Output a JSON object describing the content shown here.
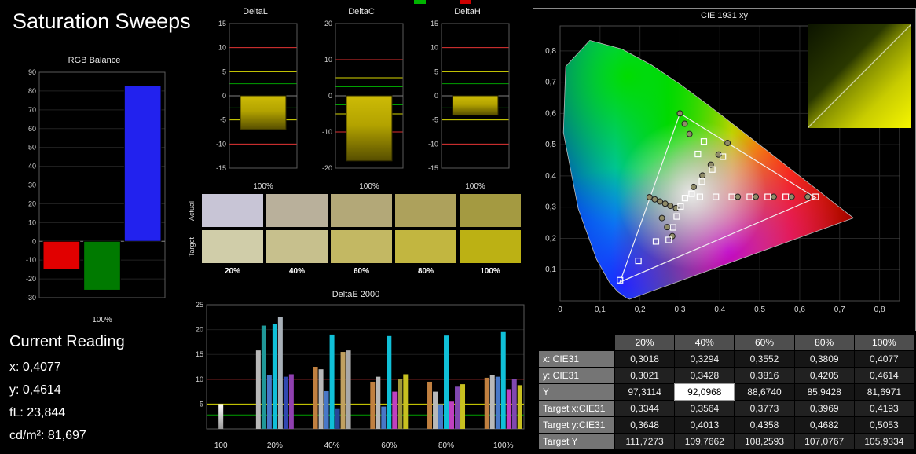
{
  "window": {
    "title": "Saturation Sweeps"
  },
  "top_markers": [
    {
      "name": "green-marker",
      "color": "#00b400"
    },
    {
      "name": "red-marker",
      "color": "#cc0000"
    }
  ],
  "current_reading": {
    "title": "Current Reading",
    "lines": [
      "x: 0,4077",
      "y: 0,4614",
      "fL: 23,844",
      "cd/m²: 81,697"
    ]
  },
  "swatches": {
    "row_labels": [
      "Actual",
      "Target"
    ],
    "col_labels": [
      "20%",
      "40%",
      "60%",
      "80%",
      "100%"
    ],
    "actual_colors": [
      "#c8c5d6",
      "#b9b09b",
      "#b3a878",
      "#ada15c",
      "#a49a41"
    ],
    "target_colors": [
      "#d0cda9",
      "#c7c08d",
      "#c3b863",
      "#c2b640",
      "#bcb114"
    ]
  },
  "table": {
    "col_headers": [
      "",
      "20%",
      "40%",
      "60%",
      "80%",
      "100%"
    ],
    "rows": [
      {
        "label": "x: CIE31",
        "values": [
          "0,3018",
          "0,3294",
          "0,3552",
          "0,3809",
          "0,4077"
        ]
      },
      {
        "label": "y: CIE31",
        "values": [
          "0,3021",
          "0,3428",
          "0,3816",
          "0,4205",
          "0,4614"
        ]
      },
      {
        "label": "Y",
        "values": [
          "97,3114",
          "92,0968",
          "88,6740",
          "85,9428",
          "81,6971"
        ]
      },
      {
        "label": "Target x:CIE31",
        "values": [
          "0,3344",
          "0,3564",
          "0,3773",
          "0,3969",
          "0,4193"
        ]
      },
      {
        "label": "Target y:CIE31",
        "values": [
          "0,3648",
          "0,4013",
          "0,4358",
          "0,4682",
          "0,5053"
        ]
      },
      {
        "label": "Target Y",
        "values": [
          "111,7273",
          "109,7662",
          "108,2593",
          "107,0767",
          "105,9334"
        ]
      }
    ],
    "highlight": {
      "row": 2,
      "col": 1
    }
  },
  "chart_data": [
    {
      "type": "bar",
      "id": "rgb-balance",
      "title": "RGB Balance",
      "xlabel": "100%",
      "ylim": [
        -30,
        90
      ],
      "yticks": [
        90,
        80,
        70,
        60,
        50,
        40,
        30,
        20,
        10,
        0,
        -10,
        -20,
        -30
      ],
      "categories": [
        "Red",
        "Green",
        "Blue"
      ],
      "values": [
        -15,
        -26,
        83
      ],
      "colors": [
        "#e10000",
        "#007a00",
        "#2222ee"
      ]
    },
    {
      "type": "bar",
      "id": "deltaL",
      "title": "DeltaL",
      "xlabel": "100%",
      "ylim": [
        -15,
        15
      ],
      "yticks": [
        15,
        10,
        5,
        0,
        -5,
        -10,
        -15
      ],
      "values": [
        -7
      ],
      "colors": [
        "#b3a300"
      ],
      "ref_lines": [
        {
          "v": 10,
          "c": "#e03030"
        },
        {
          "v": 5,
          "c": "#d8d800"
        },
        {
          "v": 2.5,
          "c": "#00a000"
        },
        {
          "v": -2.5,
          "c": "#00a000"
        },
        {
          "v": -5,
          "c": "#d8d800"
        },
        {
          "v": -10,
          "c": "#e03030"
        }
      ]
    },
    {
      "type": "bar",
      "id": "deltaC",
      "title": "DeltaC",
      "xlabel": "100%",
      "ylim": [
        -20,
        20
      ],
      "yticks": [
        20,
        10,
        0,
        -10,
        -20
      ],
      "values": [
        -18
      ],
      "colors": [
        "#b3a300"
      ],
      "ref_lines": [
        {
          "v": 10,
          "c": "#e03030"
        },
        {
          "v": 5,
          "c": "#d8d800"
        },
        {
          "v": 2.5,
          "c": "#00a000"
        },
        {
          "v": -2.5,
          "c": "#00a000"
        },
        {
          "v": -5,
          "c": "#d8d800"
        },
        {
          "v": -10,
          "c": "#e03030"
        }
      ]
    },
    {
      "type": "bar",
      "id": "deltaH",
      "title": "DeltaH",
      "xlabel": "100%",
      "ylim": [
        -15,
        15
      ],
      "yticks": [
        15,
        10,
        5,
        0,
        -5,
        -10,
        -15
      ],
      "values": [
        -4
      ],
      "colors": [
        "#b3a300"
      ],
      "ref_lines": [
        {
          "v": 10,
          "c": "#e03030"
        },
        {
          "v": 5,
          "c": "#d8d800"
        },
        {
          "v": 2.5,
          "c": "#00a000"
        },
        {
          "v": -2.5,
          "c": "#00a000"
        },
        {
          "v": -5,
          "c": "#d8d800"
        },
        {
          "v": -10,
          "c": "#e03030"
        }
      ]
    },
    {
      "type": "grouped-bar",
      "id": "deltae-2000",
      "title": "DeltaE 2000",
      "ylim": [
        0,
        25
      ],
      "yticks": [
        25,
        20,
        15,
        10,
        5
      ],
      "ref_lines": [
        {
          "v": 10,
          "c": "#e03030"
        },
        {
          "v": 5,
          "c": "#d8d800"
        },
        {
          "v": 2.8,
          "c": "#00a000"
        }
      ],
      "groups": [
        {
          "label": "100",
          "bars": [
            {
              "v": 5.0,
              "c": "#f2f2f2"
            }
          ]
        },
        {
          "label": "20%",
          "bars": [
            {
              "v": 15.8,
              "c": "#b8b8b8"
            },
            {
              "v": 20.8,
              "c": "#209898"
            },
            {
              "v": 10.8,
              "c": "#4878c8"
            },
            {
              "v": 21.2,
              "c": "#10c0d8"
            },
            {
              "v": 22.5,
              "c": "#a8b0b8"
            },
            {
              "v": 10.5,
              "c": "#3048b0"
            },
            {
              "v": 11.0,
              "c": "#9040b0"
            }
          ]
        },
        {
          "label": "40%",
          "bars": [
            {
              "v": 12.5,
              "c": "#c08040"
            },
            {
              "v": 12.0,
              "c": "#b8b8b8"
            },
            {
              "v": 7.6,
              "c": "#4878c8"
            },
            {
              "v": 19.0,
              "c": "#10c0d8"
            },
            {
              "v": 4.0,
              "c": "#284898"
            },
            {
              "v": 15.5,
              "c": "#c0a060"
            },
            {
              "v": 15.8,
              "c": "#a8a8a8"
            }
          ]
        },
        {
          "label": "60%",
          "bars": [
            {
              "v": 9.5,
              "c": "#c08040"
            },
            {
              "v": 10.5,
              "c": "#b8b8b8"
            },
            {
              "v": 4.5,
              "c": "#4878c8"
            },
            {
              "v": 18.7,
              "c": "#10c0d8"
            },
            {
              "v": 7.5,
              "c": "#c040c0"
            },
            {
              "v": 10.0,
              "c": "#a09838"
            },
            {
              "v": 11.0,
              "c": "#c8c020"
            }
          ]
        },
        {
          "label": "80%",
          "bars": [
            {
              "v": 9.5,
              "c": "#c08040"
            },
            {
              "v": 7.5,
              "c": "#b8b8b8"
            },
            {
              "v": 5.0,
              "c": "#4878c8"
            },
            {
              "v": 18.8,
              "c": "#10c0d8"
            },
            {
              "v": 5.5,
              "c": "#c040c0"
            },
            {
              "v": 8.5,
              "c": "#8048b0"
            },
            {
              "v": 9.0,
              "c": "#c8c020"
            }
          ]
        },
        {
          "label": "100%",
          "bars": [
            {
              "v": 10.3,
              "c": "#c08040"
            },
            {
              "v": 10.8,
              "c": "#b8b8b8"
            },
            {
              "v": 10.5,
              "c": "#4878c8"
            },
            {
              "v": 19.5,
              "c": "#10c0d8"
            },
            {
              "v": 8.0,
              "c": "#c040c0"
            },
            {
              "v": 10.0,
              "c": "#8048b0"
            },
            {
              "v": 8.8,
              "c": "#c8c020"
            }
          ]
        }
      ]
    },
    {
      "type": "scatter",
      "id": "cie-1931",
      "title": "CIE 1931 xy",
      "xlim": [
        0,
        0.85
      ],
      "ylim": [
        0,
        0.88
      ],
      "xticks": [
        0,
        0.1,
        0.2,
        0.3,
        0.4,
        0.5,
        0.6,
        0.7,
        0.8
      ],
      "yticks": [
        0.1,
        0.2,
        0.3,
        0.4,
        0.5,
        0.6,
        0.7,
        0.8
      ],
      "gamut_triangle": [
        [
          0.64,
          0.33
        ],
        [
          0.3,
          0.6
        ],
        [
          0.15,
          0.06
        ]
      ],
      "measured_squares": [
        [
          0.3127,
          0.329
        ],
        [
          0.3018,
          0.3021
        ],
        [
          0.3294,
          0.3428
        ],
        [
          0.3552,
          0.3816
        ],
        [
          0.3809,
          0.4205
        ],
        [
          0.4077,
          0.4614
        ],
        [
          0.35,
          0.333
        ],
        [
          0.39,
          0.333
        ],
        [
          0.43,
          0.333
        ],
        [
          0.475,
          0.333
        ],
        [
          0.52,
          0.333
        ],
        [
          0.565,
          0.333
        ],
        [
          0.64,
          0.333
        ],
        [
          0.345,
          0.47
        ],
        [
          0.36,
          0.51
        ],
        [
          0.292,
          0.27
        ],
        [
          0.283,
          0.235
        ],
        [
          0.272,
          0.195
        ],
        [
          0.24,
          0.19
        ],
        [
          0.196,
          0.128
        ],
        [
          0.15,
          0.066
        ]
      ],
      "target_circles": [
        [
          0.3344,
          0.3648
        ],
        [
          0.3564,
          0.4013
        ],
        [
          0.3773,
          0.4358
        ],
        [
          0.3969,
          0.4682
        ],
        [
          0.4193,
          0.5053
        ],
        [
          0.3,
          0.6
        ],
        [
          0.312,
          0.567
        ],
        [
          0.324,
          0.534
        ],
        [
          0.445,
          0.333
        ],
        [
          0.49,
          0.333
        ],
        [
          0.535,
          0.333
        ],
        [
          0.58,
          0.333
        ],
        [
          0.62,
          0.333
        ],
        [
          0.224,
          0.332
        ],
        [
          0.237,
          0.325
        ],
        [
          0.25,
          0.318
        ],
        [
          0.263,
          0.311
        ],
        [
          0.276,
          0.304
        ],
        [
          0.29,
          0.297
        ],
        [
          0.255,
          0.265
        ],
        [
          0.268,
          0.236
        ],
        [
          0.281,
          0.207
        ]
      ]
    }
  ]
}
